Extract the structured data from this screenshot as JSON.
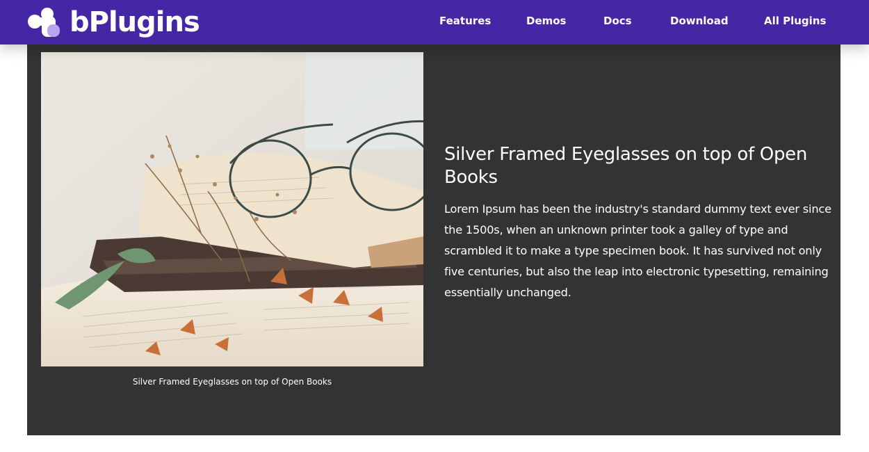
{
  "brand": {
    "name": "bPlugins",
    "accent": "#4527a5",
    "panel_bg": "#333333"
  },
  "nav": {
    "items": [
      {
        "label": "Features"
      },
      {
        "label": "Demos"
      },
      {
        "label": "Docs"
      },
      {
        "label": "Download"
      },
      {
        "label": "All Plugins"
      }
    ]
  },
  "content": {
    "image_caption": "Silver Framed Eyeglasses on top of Open Books",
    "title": " Silver Framed Eyeglasses on top of Open Books",
    "description": " Lorem Ipsum has been the industry's standard dummy text ever since the 1500s, when an unknown printer took a galley of type and scrambled it to make a type specimen book. It has survived not only five centuries, but also the leap into electronic typesetting, remaining essentially unchanged."
  }
}
